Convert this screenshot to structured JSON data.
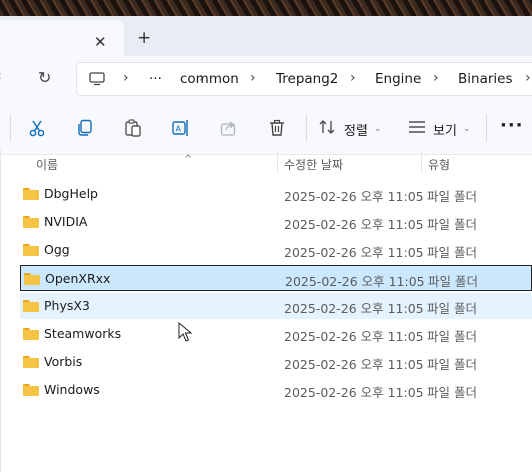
{
  "tab": {
    "close_glyph": "✕",
    "new_tab_glyph": "+"
  },
  "nav": {
    "up_glyph": "‹",
    "refresh_glyph": "↻"
  },
  "address": {
    "overflow": "···",
    "separator": "›",
    "crumbs": [
      "common",
      "Trepang2",
      "Engine",
      "Binaries"
    ]
  },
  "toolbar": {
    "sort_label": "정렬",
    "view_label": "보기",
    "more_glyph": "···",
    "icons": [
      "cut-icon",
      "copy-icon",
      "paste-icon",
      "rename-icon",
      "share-icon",
      "delete-icon",
      "sort-icon",
      "view-icon"
    ]
  },
  "columns": {
    "name": "이름",
    "date": "수정한 날짜",
    "type": "유형"
  },
  "files": [
    {
      "name": "DbgHelp",
      "date": "2025-02-26 오후 11:05",
      "type": "파일 폴더"
    },
    {
      "name": "NVIDIA",
      "date": "2025-02-26 오후 11:05",
      "type": "파일 폴더"
    },
    {
      "name": "Ogg",
      "date": "2025-02-26 오후 11:05",
      "type": "파일 폴더"
    },
    {
      "name": "OpenXRxx",
      "date": "2025-02-26 오후 11:05",
      "type": "파일 폴더",
      "state": "selected"
    },
    {
      "name": "PhysX3",
      "date": "2025-02-26 오후 11:05",
      "type": "파일 폴더",
      "state": "hover"
    },
    {
      "name": "Steamworks",
      "date": "2025-02-26 오후 11:05",
      "type": "파일 폴더"
    },
    {
      "name": "Vorbis",
      "date": "2025-02-26 오후 11:05",
      "type": "파일 폴더"
    },
    {
      "name": "Windows",
      "date": "2025-02-26 오후 11:05",
      "type": "파일 폴더"
    }
  ],
  "colors": {
    "selection": "#cce8ff",
    "hover": "#e5f3ff",
    "folder": "#f6c445",
    "accent": "#0067c0"
  }
}
